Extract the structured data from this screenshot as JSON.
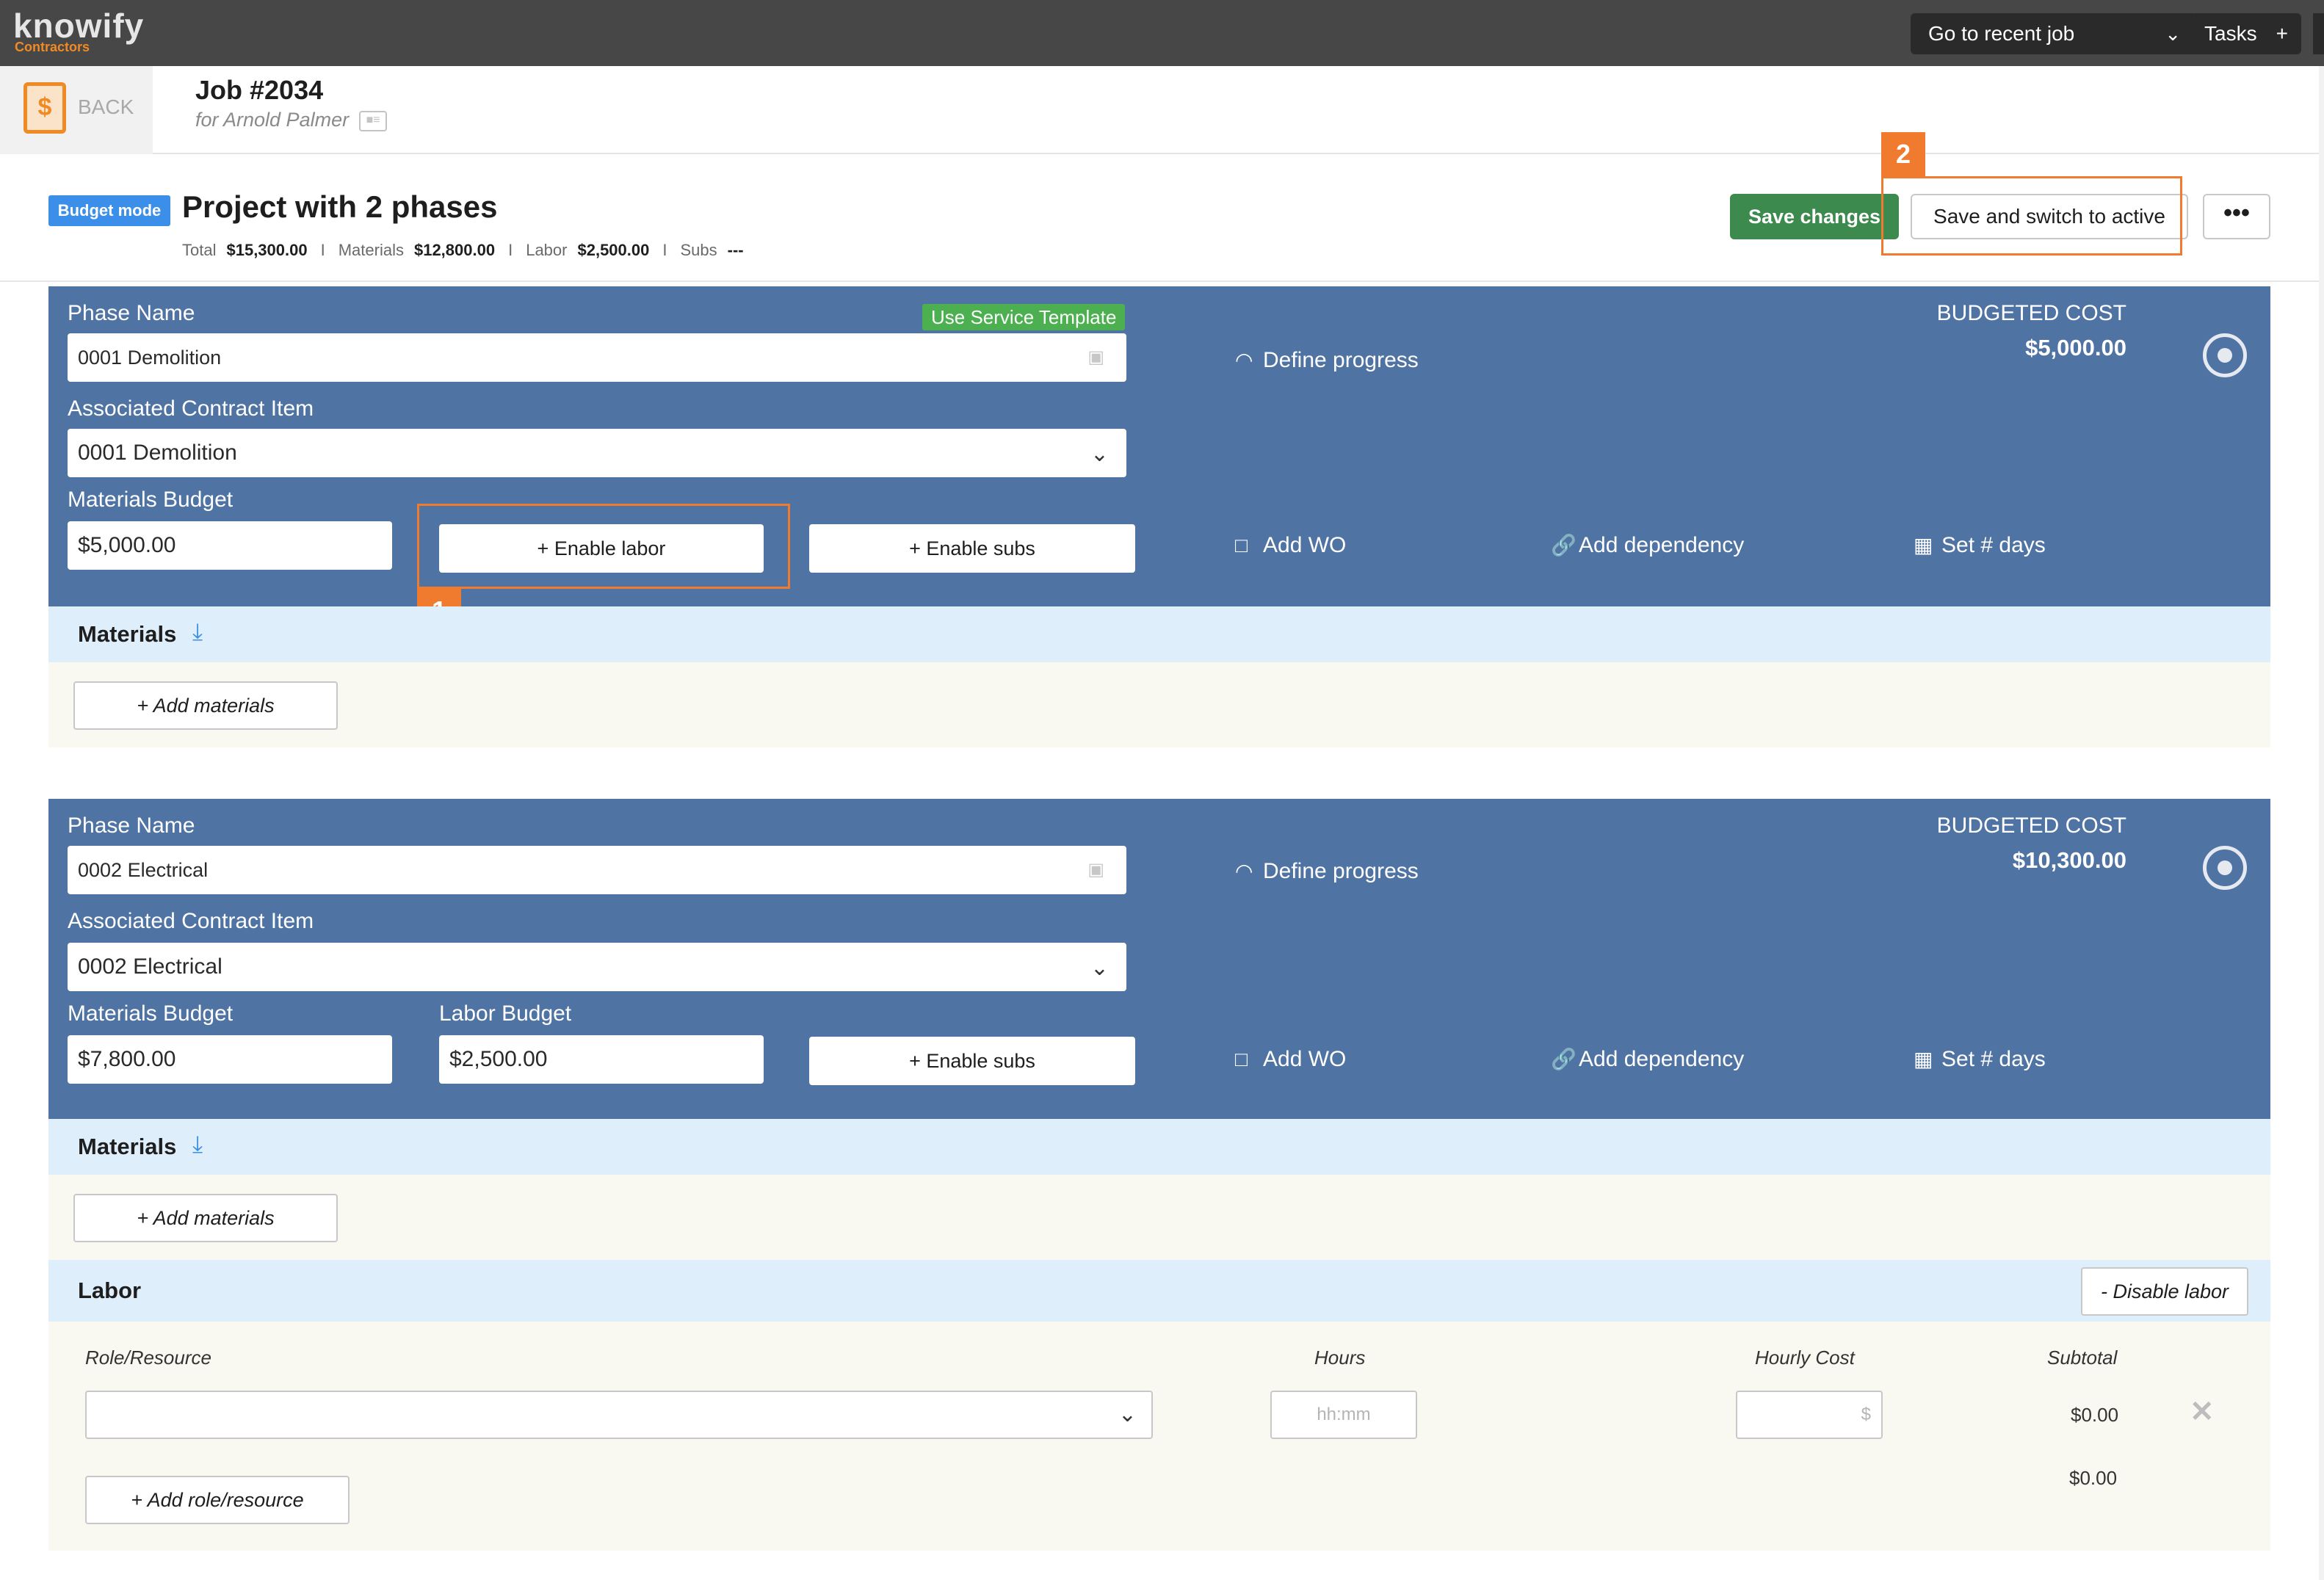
{
  "topbar": {
    "logo": "knowify",
    "logo_sub": "Contractors",
    "recent_job": "Go to recent job",
    "tasks": "Tasks"
  },
  "job": {
    "back": "BACK",
    "title": "Job #2034",
    "subtitle": "for Arnold Palmer"
  },
  "project": {
    "mode_badge": "Budget mode",
    "title": "Project with 2 phases",
    "totals": {
      "total_label": "Total",
      "total": "$15,300.00",
      "materials_label": "Materials",
      "materials": "$12,800.00",
      "labor_label": "Labor",
      "labor": "$2,500.00",
      "subs_label": "Subs",
      "subs": "---"
    },
    "save_changes": "Save changes",
    "save_switch": "Save and switch to active",
    "more": "•••"
  },
  "callouts": {
    "one": "1",
    "two": "2"
  },
  "phases": [
    {
      "phase_name_label": "Phase Name",
      "use_template": "Use Service Template",
      "phase_name": "0001 Demolition",
      "contract_label": "Associated Contract Item",
      "contract_item": "0001 Demolition",
      "materials_label": "Materials Budget",
      "materials_budget": "$5,000.00",
      "enable_labor": "+ Enable labor",
      "enable_subs": "+ Enable subs",
      "define_progress": "Define progress",
      "add_wo": "Add WO",
      "add_dependency": "Add dependency",
      "set_days": "Set # days",
      "budget_label": "BUDGETED COST",
      "budget_value": "$5,000.00",
      "materials_section": "Materials",
      "add_materials": "+ Add materials"
    },
    {
      "phase_name_label": "Phase Name",
      "phase_name": "0002 Electrical",
      "contract_label": "Associated Contract Item",
      "contract_item": "0002 Electrical",
      "materials_label": "Materials Budget",
      "materials_budget": "$7,800.00",
      "labor_label": "Labor Budget",
      "labor_budget": "$2,500.00",
      "enable_subs": "+ Enable subs",
      "define_progress": "Define progress",
      "add_wo": "Add WO",
      "add_dependency": "Add dependency",
      "set_days": "Set # days",
      "budget_label": "BUDGETED COST",
      "budget_value": "$10,300.00",
      "materials_section": "Materials",
      "add_materials": "+ Add materials",
      "labor_section": "Labor",
      "disable_labor": "- Disable labor",
      "labor_table": {
        "col_role": "Role/Resource",
        "col_hours": "Hours",
        "col_hourly": "Hourly Cost",
        "col_subtotal": "Subtotal",
        "hours_placeholder": "hh:mm",
        "hourly_placeholder": "$",
        "row_subtotal": "$0.00",
        "total": "$0.00",
        "add_role": "+ Add role/resource"
      }
    }
  ]
}
